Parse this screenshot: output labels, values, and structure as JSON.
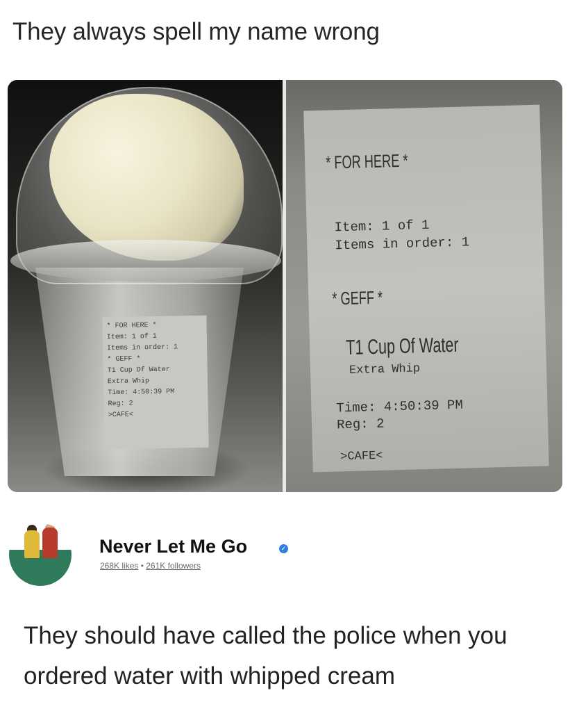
{
  "post": {
    "caption": "They always spell my name wrong"
  },
  "photo": {
    "small_label_lines": [
      "* FOR HERE *",
      "Item: 1 of 1",
      "Items in order: 1",
      "* GEFF *",
      "T1 Cup Of Water",
      "Extra Whip",
      "Time: 4:50:39 PM",
      "Reg: 2",
      ">CAFE<"
    ],
    "receipt": {
      "header": "* FOR HERE *",
      "item_line": "Item:  1 of 1",
      "items_line": "Items in order: 1",
      "name": "* GEFF *",
      "product": "T1 Cup Of Water",
      "modifier": "Extra Whip",
      "time_line": "Time:  4:50:39 PM",
      "reg_line": "Reg:   2",
      "footer": ">CAFE<"
    }
  },
  "author": {
    "name": "Never Let Me Go",
    "likes": "268K likes",
    "separator": " • ",
    "followers": "261K followers"
  },
  "comment": {
    "text": "They should have called the police when you ordered water with whipped cream"
  },
  "colors": {
    "verified": "#2f7fe0",
    "avatar_ground": "#2f7a5a"
  }
}
